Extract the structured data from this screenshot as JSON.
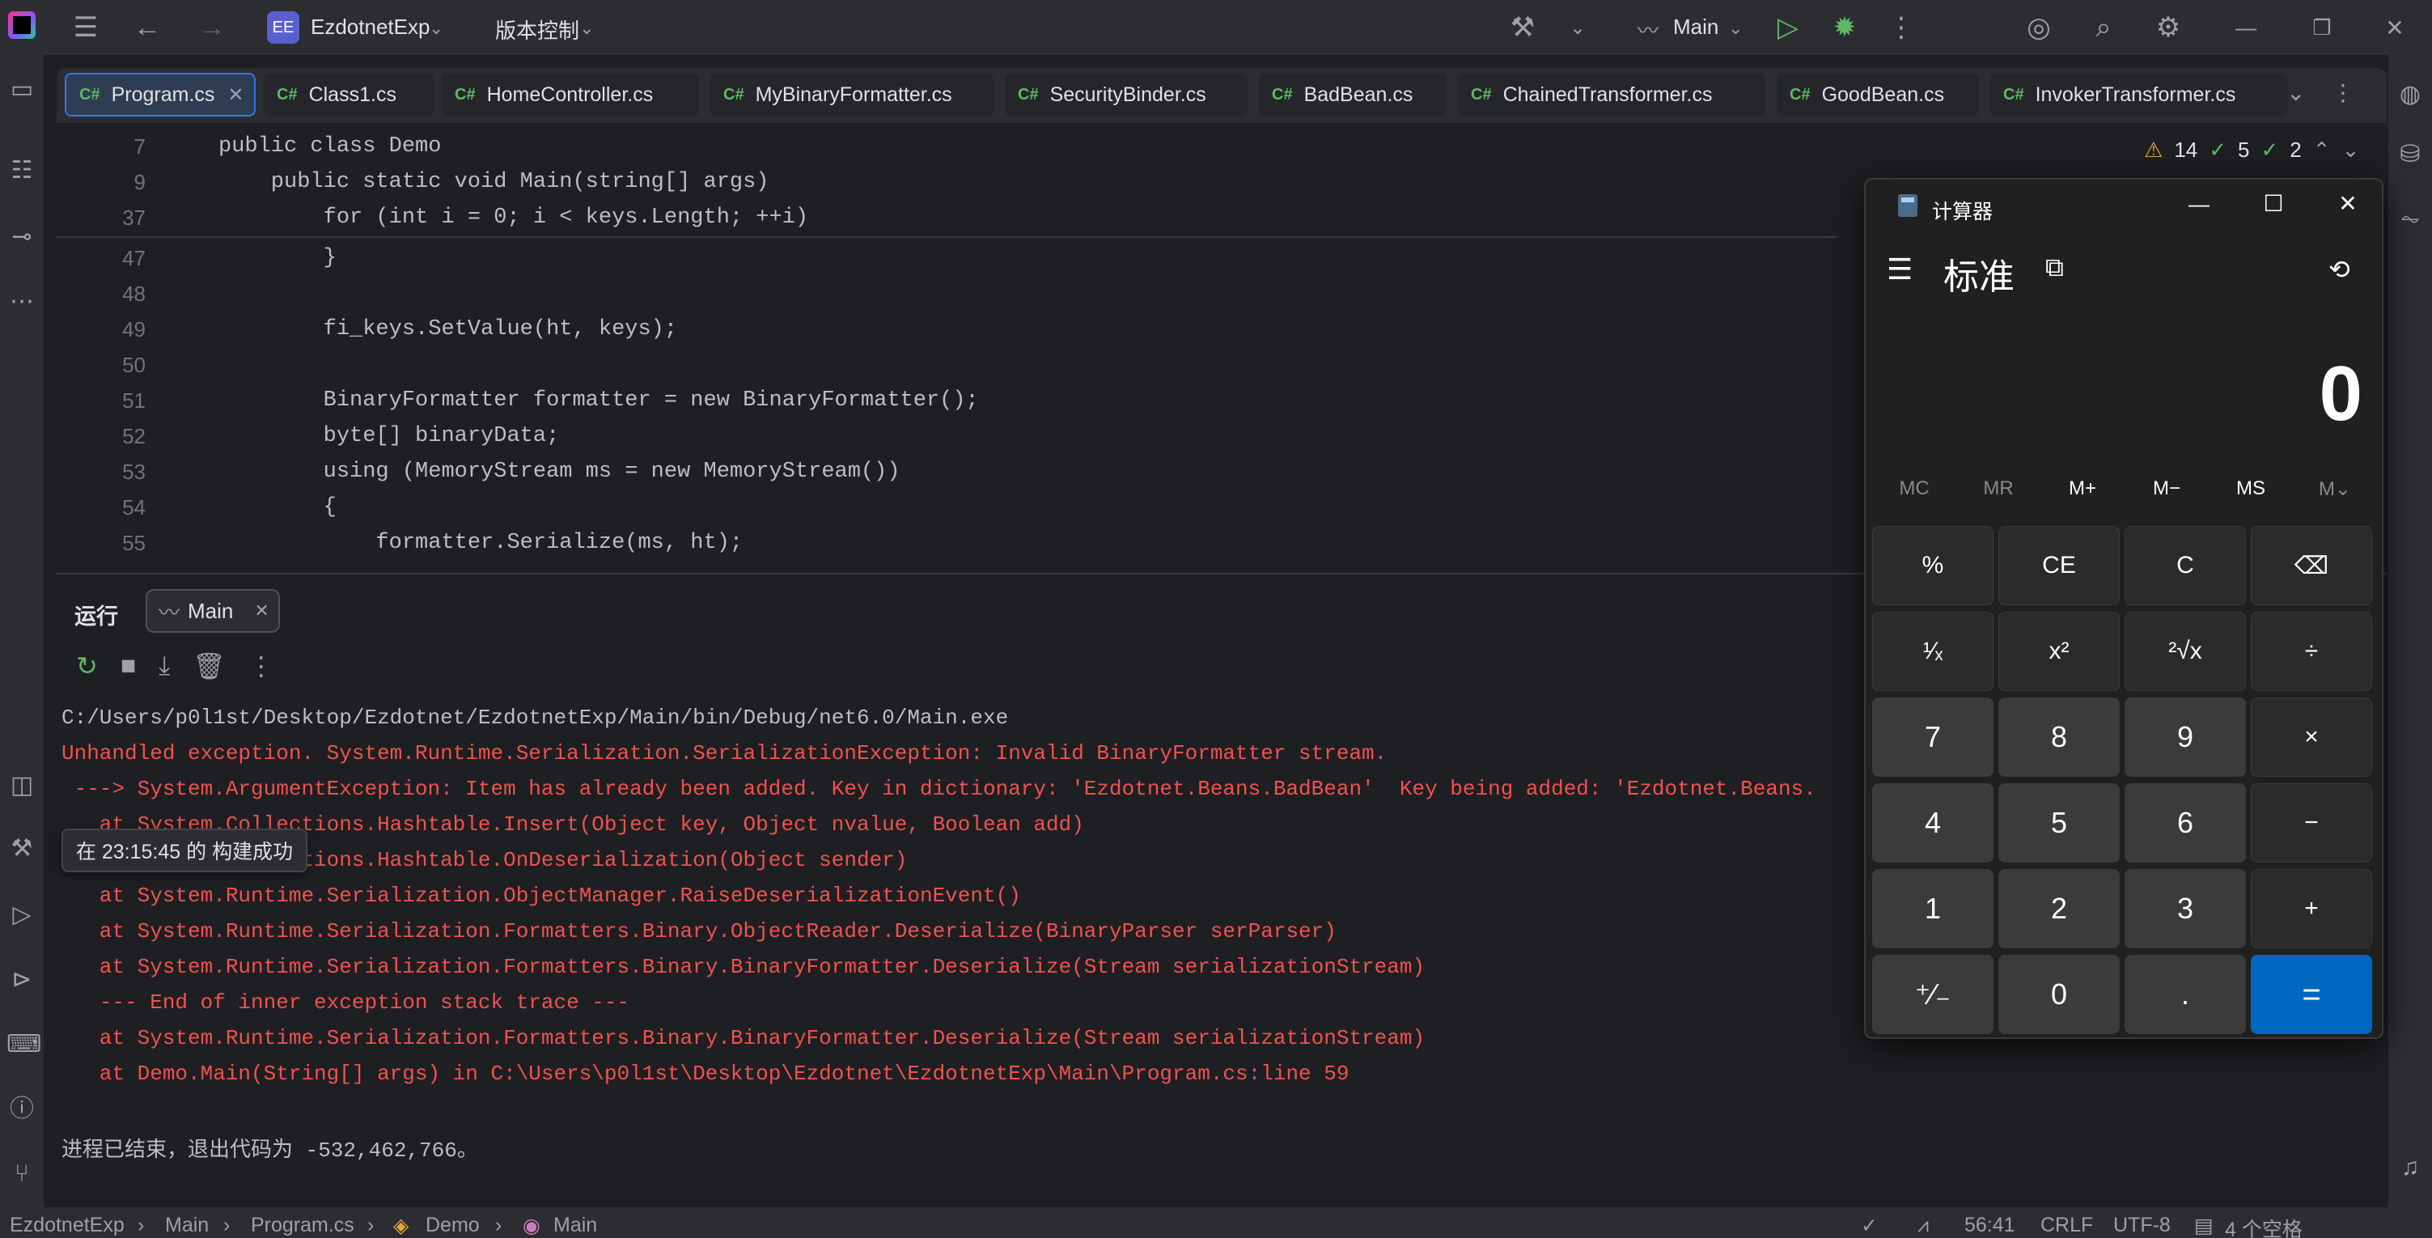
{
  "titlebar": {
    "project_badge": "EE",
    "project_name": "EzdotnetExp",
    "vcs_label": "版本控制",
    "run_config": "Main"
  },
  "tabs": [
    {
      "label": "Program.cs",
      "active": true
    },
    {
      "label": "Class1.cs"
    },
    {
      "label": "HomeController.cs"
    },
    {
      "label": "MyBinaryFormatter.cs"
    },
    {
      "label": "SecurityBinder.cs"
    },
    {
      "label": "BadBean.cs"
    },
    {
      "label": "ChainedTransformer.cs"
    },
    {
      "label": "GoodBean.cs"
    },
    {
      "label": "InvokerTransformer.cs"
    }
  ],
  "tab_lang": "C#",
  "inspections": {
    "warnings": "14",
    "ok": "5",
    "weak": "2"
  },
  "editor": {
    "lines": [
      {
        "n": "7",
        "text": "public class Demo"
      },
      {
        "n": "9",
        "text": "    public static void Main(string[] args)"
      },
      {
        "n": "37",
        "text": "        for (int i = 0; i < keys.Length; ++i)"
      },
      {
        "n": "47",
        "text": "        }"
      },
      {
        "n": "48",
        "text": ""
      },
      {
        "n": "49",
        "text": "        fi_keys.SetValue(ht, keys);"
      },
      {
        "n": "50",
        "text": ""
      },
      {
        "n": "51",
        "text": "        BinaryFormatter formatter = new BinaryFormatter();"
      },
      {
        "n": "52",
        "text": "        byte[] binaryData;"
      },
      {
        "n": "53",
        "text": "        using (MemoryStream ms = new MemoryStream())"
      },
      {
        "n": "54",
        "text": "        {"
      },
      {
        "n": "55",
        "text": "            formatter.Serialize(ms, ht);"
      }
    ]
  },
  "run": {
    "title": "运行",
    "tab": "Main",
    "output": [
      "C:/Users/p0l1st/Desktop/Ezdotnet/EzdotnetExp/Main/bin/Debug/net6.0/Main.exe",
      "Unhandled exception. System.Runtime.Serialization.SerializationException: Invalid BinaryFormatter stream.",
      " ---> System.ArgumentException: Item has already been added. Key in dictionary: 'Ezdotnet.Beans.BadBean'  Key being added: 'Ezdotnet.Beans.",
      "   at System.Collections.Hashtable.Insert(Object key, Object nvalue, Boolean add)",
      "   at System.Collections.Hashtable.OnDeserialization(Object sender)",
      "   at System.Runtime.Serialization.ObjectManager.RaiseDeserializationEvent()",
      "   at System.Runtime.Serialization.Formatters.Binary.ObjectReader.Deserialize(BinaryParser serParser)",
      "   at System.Runtime.Serialization.Formatters.Binary.BinaryFormatter.Deserialize(Stream serializationStream)",
      "   --- End of inner exception stack trace ---",
      "   at System.Runtime.Serialization.Formatters.Binary.BinaryFormatter.Deserialize(Stream serializationStream)",
      "   at Demo.Main(String[] args) in C:\\Users\\p0l1st\\Desktop\\Ezdotnet\\EzdotnetExp\\Main\\Program.cs:line 59",
      "",
      "进程已结束，退出代码为 -532,462,766。"
    ],
    "build_tooltip": "在 23:15:45 的 构建成功"
  },
  "statusbar": {
    "crumbs": [
      "EzdotnetExp",
      "Main",
      "Program.cs",
      "Demo",
      "Main"
    ],
    "position": "56:41",
    "line_ending": "CRLF",
    "encoding": "UTF-8",
    "indent": "4 个空格"
  },
  "calculator": {
    "title": "计算器",
    "mode": "标准",
    "display": "0",
    "memory": [
      "MC",
      "MR",
      "M+",
      "M−",
      "MS",
      "M⌄"
    ],
    "keys": [
      [
        "%",
        "CE",
        "C",
        "⌫"
      ],
      [
        "¹⁄ₓ",
        "x²",
        "²√x",
        "÷"
      ],
      [
        "7",
        "8",
        "9",
        "×"
      ],
      [
        "4",
        "5",
        "6",
        "−"
      ],
      [
        "1",
        "2",
        "3",
        "+"
      ],
      [
        "⁺⁄₋",
        "0",
        ".",
        "="
      ]
    ]
  }
}
